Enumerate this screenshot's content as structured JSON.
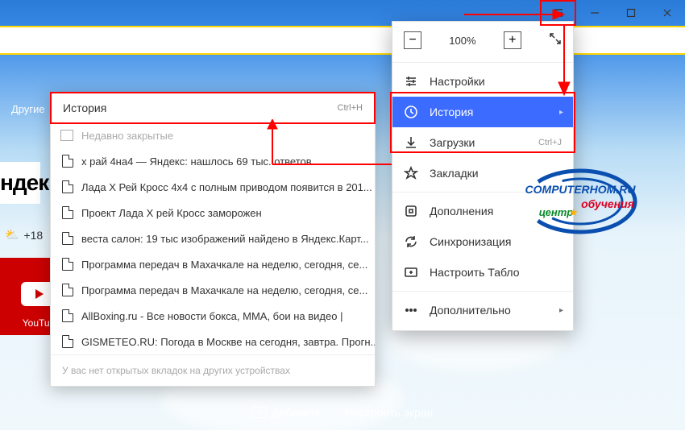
{
  "window": {
    "minimize": "–",
    "maximize": "☐",
    "close": "✕"
  },
  "other_label": "Другие",
  "yandex_brand": "ндек",
  "weather": {
    "icon": "⛅",
    "temp": "+18"
  },
  "youtube_label": "YouTub",
  "bottom": {
    "add": "Добавить",
    "configure": "Настроить экран"
  },
  "history_panel": {
    "title": "История",
    "shortcut": "Ctrl+H",
    "recently_closed": "Недавно закрытые",
    "items": [
      "х рай 4на4 — Яндекс: нашлось 69 тыс. ответов",
      "Лада Х Рей Кросс 4х4 с полным приводом появится в 201...",
      "Проект Лада Х рей Кросс заморожен",
      "веста салон: 19 тыс изображений найдено в Яндекс.Карт...",
      "Программа передач в Махачкале на неделю, сегодня, се...",
      "Программа передач в Махачкале на неделю, сегодня, се...",
      "AllBoxing.ru - Все новости бокса, MMA, бои на видео |",
      "GISMETEO.RU: Погода в Москве на сегодня, завтра. Прогн..."
    ],
    "footer": "У вас нет открытых вкладок на других устройствах"
  },
  "menu": {
    "zoom": "100%",
    "settings": "Настройки",
    "history": "История",
    "downloads": "Загрузки",
    "downloads_hint": "Ctrl+J",
    "bookmarks": "Закладки",
    "addons": "Дополнения",
    "sync": "Синхронизация",
    "tableau": "Настроить Табло",
    "more": "Дополнительно"
  },
  "stamp": {
    "domain": "COMPUTERHOM.RU",
    "center": "центр",
    "training": "обучения"
  }
}
